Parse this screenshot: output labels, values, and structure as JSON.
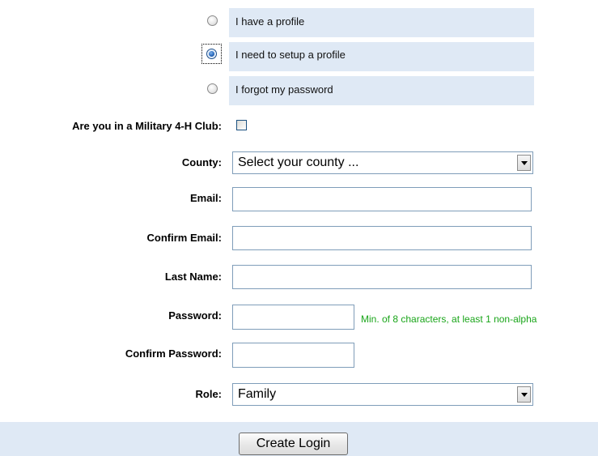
{
  "profile_options": [
    {
      "label": "I have a profile",
      "checked": false
    },
    {
      "label": "I need to setup a profile",
      "checked": true
    },
    {
      "label": "I forgot my password",
      "checked": false
    }
  ],
  "form": {
    "military_label": "Are you in a Military 4-H Club:",
    "military_checked": false,
    "county_label": "County:",
    "county_value": "Select your county ...",
    "email_label": "Email:",
    "email_value": "",
    "confirm_email_label": "Confirm Email:",
    "confirm_email_value": "",
    "last_name_label": "Last Name:",
    "last_name_value": "",
    "password_label": "Password:",
    "password_value": "",
    "password_hint": "Min. of 8 characters, at least 1 non-alpha",
    "confirm_password_label": "Confirm Password:",
    "confirm_password_value": "",
    "role_label": "Role:",
    "role_value": "Family"
  },
  "actions": {
    "create_login_label": "Create Login"
  },
  "colors": {
    "band_background": "#dfe9f5",
    "hint_text": "#19a519",
    "input_border": "#7f9db9"
  }
}
